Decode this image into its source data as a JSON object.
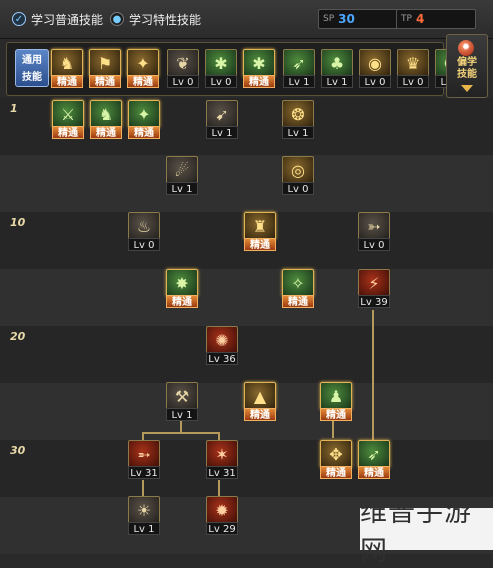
{
  "top": {
    "radio_normal": "学习普通技能",
    "radio_special": "学习特性技能",
    "stat_sp_label": "SP",
    "stat_sp_value": "30",
    "stat_tp_label": "TP",
    "stat_tp_value": "4",
    "color_sp": "#4da6ff",
    "color_tp": "#ff6a3a"
  },
  "hotbar": {
    "label_line1": "通用",
    "label_line2": "技能",
    "skills": [
      {
        "icon": "warrior-icon",
        "glyph": "♞",
        "color": "gold",
        "badge": "精通",
        "mastered": true
      },
      {
        "icon": "kick-icon",
        "glyph": "⚑",
        "color": "gold",
        "badge": "精通",
        "mastered": true
      },
      {
        "icon": "strike-icon",
        "glyph": "✦",
        "color": "gold",
        "badge": "精通",
        "mastered": true
      },
      {
        "icon": "wings-icon",
        "glyph": "❦",
        "color": "gray",
        "badge": "Lv 0",
        "mastered": false
      },
      {
        "icon": "target-icon",
        "glyph": "✱",
        "color": "green",
        "badge": "Lv 0",
        "mastered": false
      },
      {
        "icon": "target2-icon",
        "glyph": "✱",
        "color": "green",
        "badge": "精通",
        "mastered": true
      },
      {
        "icon": "dash-icon",
        "glyph": "➶",
        "color": "green",
        "badge": "Lv 1",
        "mastered": false
      },
      {
        "icon": "tree-icon",
        "glyph": "♣",
        "color": "green",
        "badge": "Lv 1",
        "mastered": false
      },
      {
        "icon": "shield-icon",
        "glyph": "◉",
        "color": "gold",
        "badge": "Lv 0",
        "mastered": false
      },
      {
        "icon": "buff-icon",
        "glyph": "♛",
        "color": "gold",
        "badge": "Lv 0",
        "mastered": false
      },
      {
        "icon": "runner-icon",
        "glyph": "✪",
        "color": "green",
        "badge": "Lv 0",
        "mastered": false
      }
    ]
  },
  "side_button": {
    "line1": "偏学",
    "line2": "技能"
  },
  "tree": {
    "row_labels": [
      "1",
      "10",
      "20",
      "30"
    ],
    "skills": [
      {
        "name": "skill-a1",
        "glyph": "⚔",
        "color": "green",
        "badge": "精通",
        "mastered": true
      },
      {
        "name": "skill-a2",
        "glyph": "♞",
        "color": "green",
        "badge": "精通",
        "mastered": true
      },
      {
        "name": "skill-a3",
        "glyph": "✦",
        "color": "green",
        "badge": "精通",
        "mastered": true
      },
      {
        "name": "skill-a4",
        "glyph": "➹",
        "color": "gray",
        "badge": "Lv 1",
        "mastered": false
      },
      {
        "name": "skill-a5",
        "glyph": "❂",
        "color": "gold",
        "badge": "Lv 1",
        "mastered": false
      },
      {
        "name": "skill-b1",
        "glyph": "☄",
        "color": "gray",
        "badge": "Lv 1",
        "mastered": false
      },
      {
        "name": "skill-b2",
        "glyph": "◎",
        "color": "gold",
        "badge": "Lv 0",
        "mastered": false
      },
      {
        "name": "skill-c1",
        "glyph": "♨",
        "color": "gray",
        "badge": "Lv 0",
        "mastered": false
      },
      {
        "name": "skill-c2",
        "glyph": "♜",
        "color": "gold",
        "badge": "精通",
        "mastered": true
      },
      {
        "name": "skill-c3",
        "glyph": "➳",
        "color": "gray",
        "badge": "Lv 0",
        "mastered": false
      },
      {
        "name": "skill-d1",
        "glyph": "✸",
        "color": "green",
        "badge": "精通",
        "mastered": true
      },
      {
        "name": "skill-d2",
        "glyph": "✧",
        "color": "green",
        "badge": "精通",
        "mastered": true
      },
      {
        "name": "skill-d3",
        "glyph": "⚡",
        "color": "red",
        "badge": "Lv 39",
        "mastered": false
      },
      {
        "name": "skill-e1",
        "glyph": "✺",
        "color": "red",
        "badge": "Lv 36",
        "mastered": false
      },
      {
        "name": "skill-f1",
        "glyph": "⚒",
        "color": "gray",
        "badge": "Lv 1",
        "mastered": false
      },
      {
        "name": "skill-f2",
        "glyph": "▲",
        "color": "gold",
        "badge": "精通",
        "mastered": true
      },
      {
        "name": "skill-f3",
        "glyph": "♟",
        "color": "green",
        "badge": "精通",
        "mastered": true
      },
      {
        "name": "skill-g1",
        "glyph": "➵",
        "color": "red",
        "badge": "Lv 31",
        "mastered": false
      },
      {
        "name": "skill-g2",
        "glyph": "✶",
        "color": "red",
        "badge": "Lv 31",
        "mastered": false
      },
      {
        "name": "skill-g3",
        "glyph": "✥",
        "color": "gold",
        "badge": "精通",
        "mastered": true
      },
      {
        "name": "skill-g4",
        "glyph": "➶",
        "color": "green",
        "badge": "精通",
        "mastered": true
      },
      {
        "name": "skill-h1",
        "glyph": "☀",
        "color": "gray",
        "badge": "Lv 1",
        "mastered": false
      },
      {
        "name": "skill-h2",
        "glyph": "✹",
        "color": "red",
        "badge": "Lv 29",
        "mastered": false
      }
    ]
  },
  "watermark": "维普手游网"
}
